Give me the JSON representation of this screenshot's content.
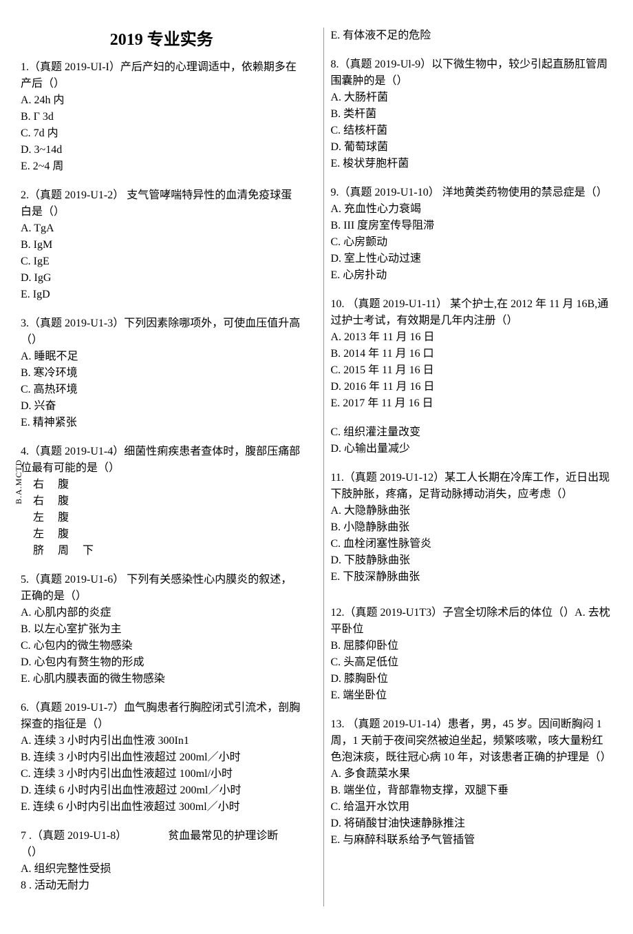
{
  "title": "2019 专业实务",
  "left": {
    "q1": {
      "stem": "1.（真题 2019-UI-I）产后产妇的心理调适中，依赖期多在产后（）",
      "a": "A. 24h 内",
      "b": "B. Γ 3d",
      "c": "C. 7d 内",
      "d": "D. 3~14d",
      "e": "E. 2~4 周"
    },
    "q2": {
      "stem": "2.（真题 2019-U1-2）  支气管哮喘特异性的血清免疫球蛋白是（）",
      "a": "A. TgA",
      "b": "B. IgM",
      "c": "C. IgE",
      "d": "D. IgG",
      "e": "E. IgD"
    },
    "q3": {
      "stem": "3.（真题 2019-U1-3）下列因素除哪项外，可使血压值升高（）",
      "a": "A. 睡眠不足",
      "b": "B. 寒冷环境",
      "c": "C. 高热环境",
      "d": "D. 兴奋",
      "e": "E. 精神紧张"
    },
    "q4": {
      "stem": "4.（真题 2019-U1-4）细菌性痢疾患者查体时，腹部压痛部位最有可能的是（）",
      "rotated": "B.A.MCTD",
      "row1l": "右",
      "row1r": "腹",
      "row2l": "右",
      "row2r": "腹",
      "row3l": "左",
      "row3r": "腹",
      "row4l": "左",
      "row4r": "腹",
      "last": "脐 周 下"
    },
    "q5": {
      "stem": "5.（真题 2019-U1-6）  下列有关感染性心内膜炎的叙述，正确的是（）",
      "a": "A. 心肌内部的炎症",
      "b": "B. 以左心室扩张为主",
      "c": "C. 心包内的微生物感染",
      "d": "D. 心包内有赘生物的形成",
      "e": "E. 心肌内膜表面的微生物感染"
    },
    "q6": {
      "stem": "6.（真题 2019-U1-7）血气胸患者行胸腔闭式引流术，剖胸探查的指征是（）",
      "a": "A. 连续 3 小时内引出血性液 300In1",
      "b": "B. 连续 3 小时内引出血性液超过 200ml／小时",
      "c": "C. 连续 3 小时内引出血性液超过 100ml/小时",
      "d": "D. 连续 6 小时内引出血性液超过 200ml／小时",
      "e": "E. 连续 6 小时内引出血性液超过 300ml／小时"
    },
    "q7": {
      "stem1": "7  .（真题 2019-U1-8）",
      "stem2": "贫血最常见的护理诊断",
      "stem3": "（）",
      "a": "A. 组织完整性受损",
      "b": "8  . 活动无耐力"
    }
  },
  "right": {
    "q7e": "E. 有体液不足的危险",
    "q8": {
      "stem": "8.（真题 2019-Ul-9）以下微生物中，较少引起直肠肛管周围囊肿的是（）",
      "a": "A. 大肠杆菌",
      "b": "B. 类杆菌",
      "c": "C. 结核杆菌",
      "d": "D. 葡萄球菌",
      "e": "E. 梭状芽胞杆菌"
    },
    "q9": {
      "stem": "9.（真题 2019-U1-10）   洋地黄类药物使用的禁忌症是（）",
      "a": "A. 充血性心力衰竭",
      "b": "B. III 度房室传导阻滞",
      "c": "C. 心房颤动",
      "d": "D. 室上性心动过速",
      "e": "E. 心房扑动"
    },
    "q10": {
      "stem": "10. （真题 2019-U1-11）  某个护士,在 2012 年 11 月 16B,通过护士考试，有效期是几年内注册（）",
      "a": "A. 2013 年 11 月 16 日",
      "b": "B. 2014 年 11 月 16 口",
      "c": "C. 2015 年 11 月 16 日",
      "d": "D. 2016 年 11 月 16 日",
      "e": "E. 2017 年 11 月 16 日"
    },
    "q7cd": {
      "c": "C. 组织灌注量改变",
      "d": "D. 心输出量减少"
    },
    "q11": {
      "stem": "11.（真题 2019-U1-12）某工人长期在冷库工作，近日出现下肢肿胀，疼痛，足背动脉搏动消失，应考虑（）",
      "a": "A. 大隐静脉曲张",
      "b": "B. 小隐静脉曲张",
      "c": "C. 血栓闭塞性脉管炎",
      "d": "D. 下肢静脉曲张",
      "e": "E. 下肢深静脉曲张"
    },
    "q12": {
      "stem": "12.（真题 2019-U1T3）子宫全切除术后的体位（）A. 去枕平卧位",
      "b": "B. 屈膝仰卧位",
      "c": "C. 头高足低位",
      "d": "D. 膝胸卧位",
      "e": "E. 端坐卧位"
    },
    "q13": {
      "stem": "13. （真题 2019-U1-14）患者，男，45 岁。因间断胸闷 1 周，1 天前于夜间突然被迫坐起，频繁咳嗽，咳大量粉红色泡沫痰，既往冠心病 10 年，对该患者正确的护理是（）",
      "a": "A. 多食蔬菜水果",
      "b": "B. 端坐位，背部靠物支撑，双腿下垂",
      "c": "C. 给温开水饮用",
      "d": "D. 将硝酸甘油快速静脉推注",
      "e": "E. 与麻醉科联系给予气管插管"
    }
  }
}
